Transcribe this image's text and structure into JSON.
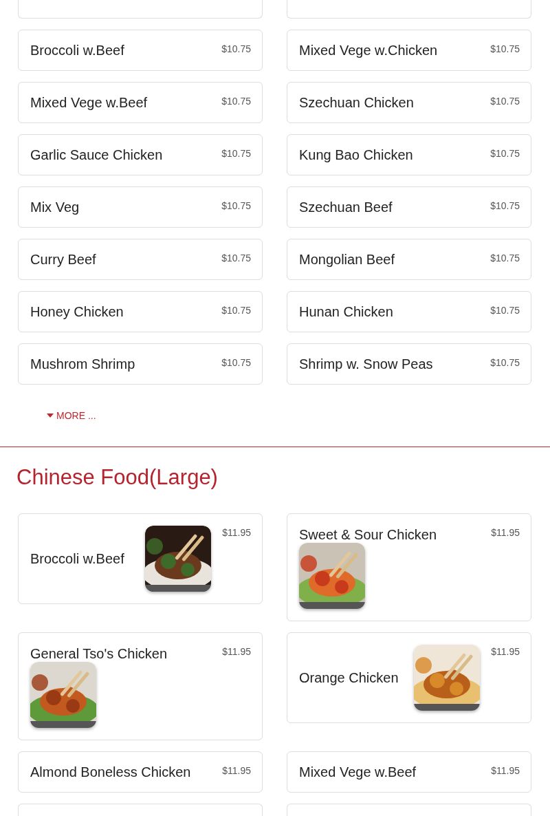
{
  "regular_items": [
    {
      "name": "Broccoli w.Beef",
      "price": "$10.75"
    },
    {
      "name": "Mixed Vege w.Chicken",
      "price": "$10.75"
    },
    {
      "name": "Mixed Vege w.Beef",
      "price": "$10.75"
    },
    {
      "name": "Szechuan Chicken",
      "price": "$10.75"
    },
    {
      "name": "Garlic Sauce Chicken",
      "price": "$10.75"
    },
    {
      "name": "Kung Bao Chicken",
      "price": "$10.75"
    },
    {
      "name": "Mix Veg",
      "price": "$10.75"
    },
    {
      "name": "Szechuan Beef",
      "price": "$10.75"
    },
    {
      "name": "Curry Beef",
      "price": "$10.75"
    },
    {
      "name": "Mongolian Beef",
      "price": "$10.75"
    },
    {
      "name": "Honey Chicken",
      "price": "$10.75"
    },
    {
      "name": "Hunan Chicken",
      "price": "$10.75"
    },
    {
      "name": "Mushrom Shrimp",
      "price": "$10.75"
    },
    {
      "name": "Shrimp w. Snow Peas",
      "price": "$10.75"
    }
  ],
  "more_link": "MORE ...",
  "section_title": "Chinese Food(Large)",
  "large_items": [
    {
      "name": "Broccoli w.Beef",
      "price": "$11.95",
      "kind": "side"
    },
    {
      "name": "Sweet & Sour Chicken",
      "price": "$11.95",
      "kind": "below"
    },
    {
      "name": "General Tso's Chicken",
      "price": "$11.95",
      "kind": "below"
    },
    {
      "name": "Orange Chicken",
      "price": "$11.95",
      "kind": "side"
    },
    {
      "name": "Almond Boneless Chicken",
      "price": "$11.95",
      "kind": "plain"
    },
    {
      "name": "Mixed Vege w.Beef",
      "price": "$11.95",
      "kind": "plain"
    }
  ]
}
